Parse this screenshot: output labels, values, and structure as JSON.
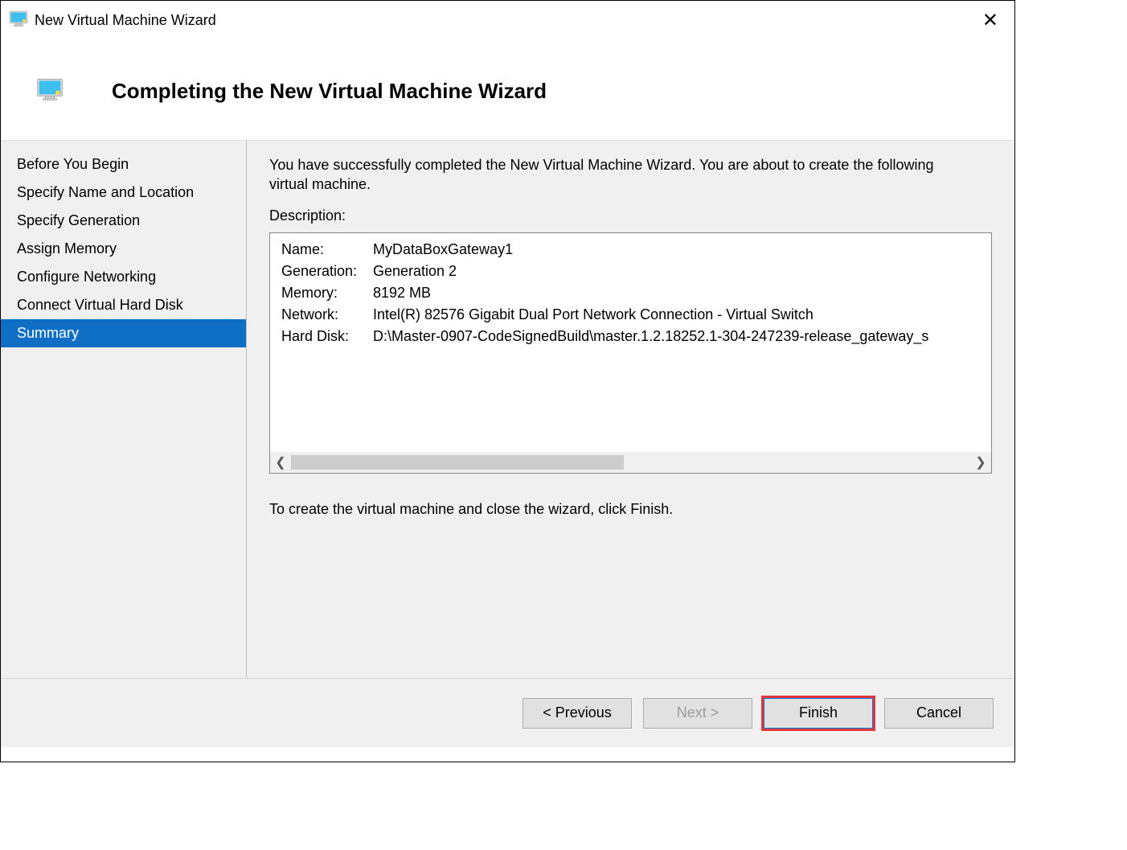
{
  "titlebar": {
    "title": "New Virtual Machine Wizard"
  },
  "header": {
    "title": "Completing the New Virtual Machine Wizard"
  },
  "sidebar": {
    "steps": [
      "Before You Begin",
      "Specify Name and Location",
      "Specify Generation",
      "Assign Memory",
      "Configure Networking",
      "Connect Virtual Hard Disk",
      "Summary"
    ],
    "active_index": 6
  },
  "content": {
    "intro": "You have successfully completed the New Virtual Machine Wizard. You are about to create the following virtual machine.",
    "description_label": "Description:",
    "properties": [
      {
        "key": "Name:",
        "value": "MyDataBoxGateway1"
      },
      {
        "key": "Generation:",
        "value": "Generation 2"
      },
      {
        "key": "Memory:",
        "value": "8192 MB"
      },
      {
        "key": "Network:",
        "value": "Intel(R) 82576 Gigabit Dual Port Network Connection - Virtual Switch"
      },
      {
        "key": "Hard Disk:",
        "value": "D:\\Master-0907-CodeSignedBuild\\master.1.2.18252.1-304-247239-release_gateway_s"
      }
    ],
    "closing_text": "To create the virtual machine and close the wizard, click Finish."
  },
  "footer": {
    "previous": "< Previous",
    "next": "Next >",
    "finish": "Finish",
    "cancel": "Cancel"
  }
}
